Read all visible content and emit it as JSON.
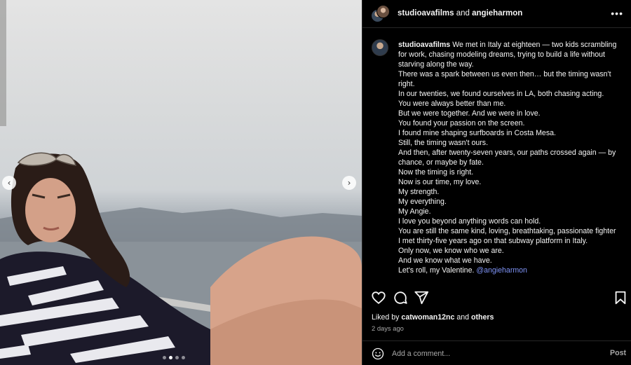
{
  "header": {
    "user1": "studioavafilms",
    "conj": "and",
    "user2": "angieharmon",
    "more_icon": "more-horizontal-icon"
  },
  "caption": {
    "username": "studioavafilms",
    "lines": [
      "We met in Italy at eighteen — two kids scrambling for work, chasing modeling dreams, trying to build a life without starving along the way.",
      "There was a spark between us even then… but the timing wasn't right.",
      "In our twenties, we found ourselves in LA, both chasing acting.",
      "You were always better than me.",
      "But we were together. And we were in love.",
      "You found your passion on the screen.",
      "I found mine shaping surfboards in Costa Mesa.",
      "Still, the timing wasn't ours.",
      "And then, after twenty-seven years, our paths crossed again — by chance, or maybe by fate.",
      "Now the timing is right.",
      "Now is our time, my love.",
      "My strength.",
      "My everything.",
      "My Angie.",
      "I love you beyond anything words can hold.",
      "You are still the same kind, loving, breathtaking, passionate fighter I met thirty-five years ago on that subway platform in Italy.",
      "Only now, we know who we are.",
      "And we know what we have."
    ],
    "last_line": "Let's roll, my Valentine.",
    "mention": "@angieharmon"
  },
  "likes": {
    "prefix": "Liked by",
    "user": "catwoman12nc",
    "conj": "and",
    "others": "others"
  },
  "date": "2 days ago",
  "comment": {
    "placeholder": "Add a comment...",
    "post_label": "Post"
  },
  "carousel": {
    "prev": "‹",
    "next": "›",
    "active_index": 1,
    "count": 4
  }
}
